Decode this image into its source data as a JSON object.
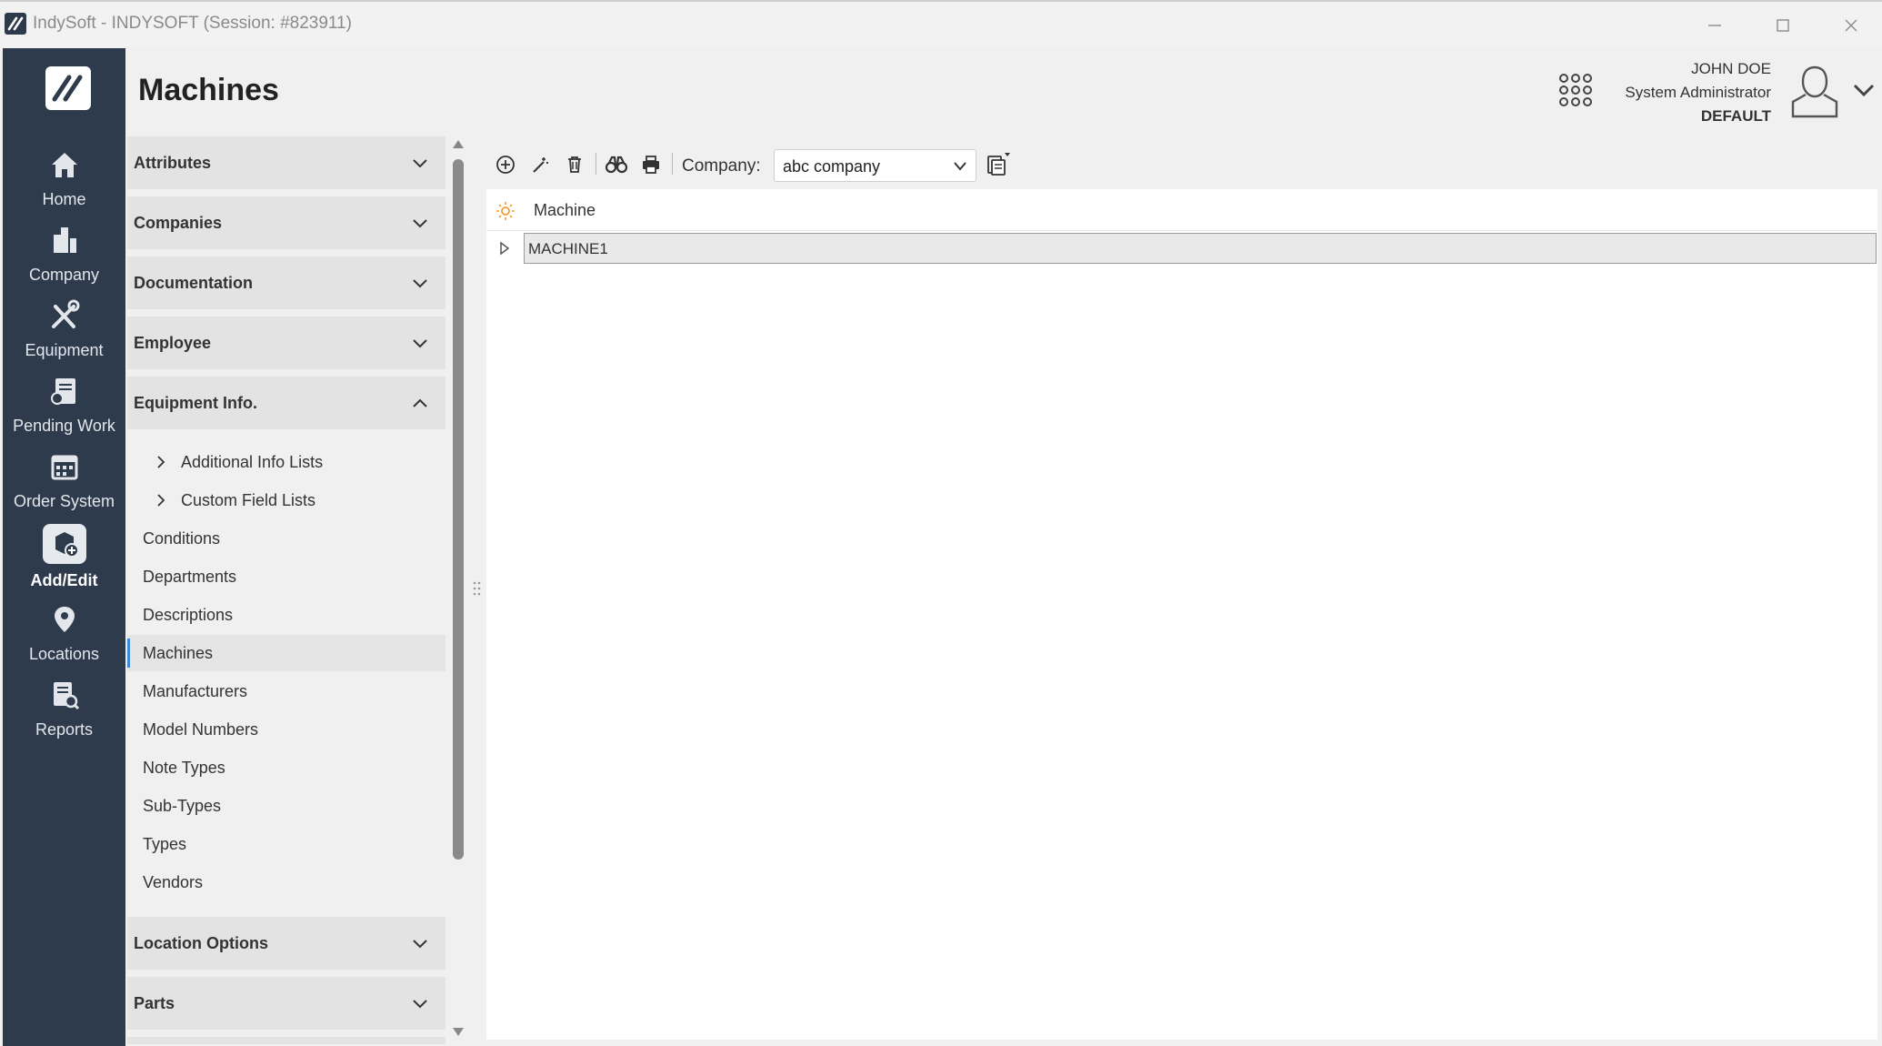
{
  "window": {
    "title": "IndySoft - INDYSOFT (Session: #823911)"
  },
  "nav": {
    "items": [
      {
        "label": "Home",
        "icon": "home-icon"
      },
      {
        "label": "Company",
        "icon": "building-icon"
      },
      {
        "label": "Equipment",
        "icon": "tools-icon"
      },
      {
        "label": "Pending Work",
        "icon": "pending-work-icon"
      },
      {
        "label": "Order System",
        "icon": "calendar-icon"
      },
      {
        "label": "Add/Edit",
        "icon": "add-edit-icon",
        "active": true
      },
      {
        "label": "Locations",
        "icon": "location-pin-icon"
      },
      {
        "label": "Reports",
        "icon": "report-search-icon"
      }
    ]
  },
  "header": {
    "page_title": "Machines",
    "user_name": "JOHN DOE",
    "user_role": "System Administrator",
    "user_profile": "DEFAULT"
  },
  "menu": {
    "sections": [
      {
        "label": "Attributes",
        "expanded": false
      },
      {
        "label": "Companies",
        "expanded": false
      },
      {
        "label": "Documentation",
        "expanded": false
      },
      {
        "label": "Employee",
        "expanded": false
      },
      {
        "label": "Equipment Info.",
        "expanded": true
      },
      {
        "label": "Location Options",
        "expanded": false
      },
      {
        "label": "Parts",
        "expanded": false
      }
    ],
    "equipment_items": [
      {
        "label": "Additional Info Lists",
        "has_children": true
      },
      {
        "label": "Custom Field Lists",
        "has_children": true
      },
      {
        "label": "Conditions"
      },
      {
        "label": "Departments"
      },
      {
        "label": "Descriptions"
      },
      {
        "label": "Machines",
        "selected": true
      },
      {
        "label": "Manufacturers"
      },
      {
        "label": "Model Numbers"
      },
      {
        "label": "Note Types"
      },
      {
        "label": "Sub-Types"
      },
      {
        "label": "Types"
      },
      {
        "label": "Vendors"
      }
    ]
  },
  "toolbar": {
    "buttons": [
      "add-icon",
      "edit-wand-icon",
      "delete-icon",
      "binoculars-icon",
      "print-icon"
    ],
    "company_label": "Company:",
    "company_value": "abc company"
  },
  "grid": {
    "column": "Machine",
    "rows": [
      "MACHINE1"
    ]
  },
  "colors": {
    "nav_bg": "#2e3b4d",
    "accent": "#3b8ad8",
    "sun_icon": "#f0a030"
  }
}
